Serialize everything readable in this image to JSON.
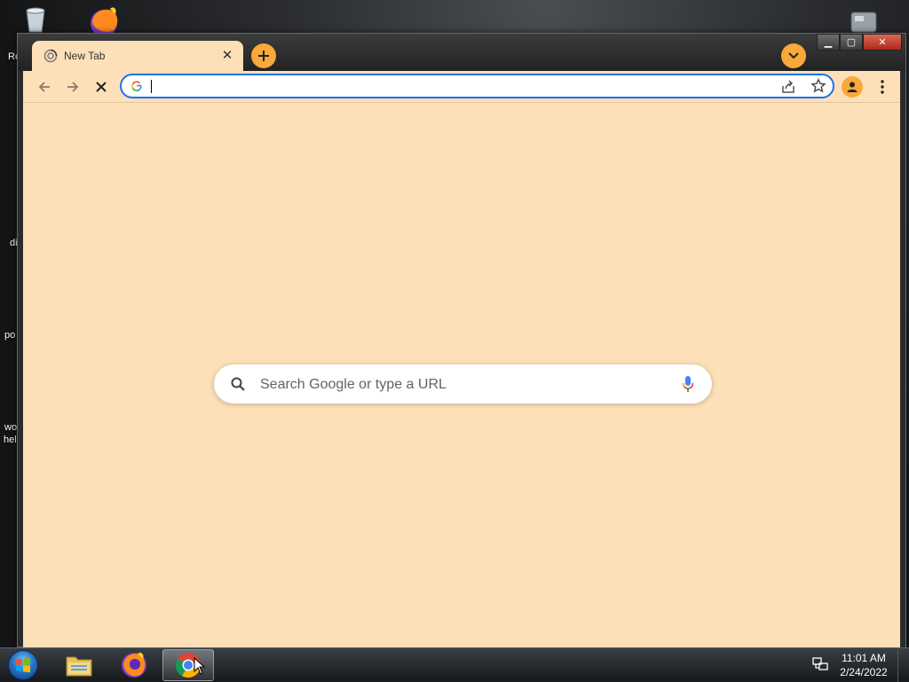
{
  "desktop": {
    "icon_labels": [
      "Re",
      "di",
      "po",
      "wo",
      "hel"
    ]
  },
  "browser": {
    "tab": {
      "title": "New Tab",
      "close_glyph": "✕"
    },
    "window_controls": {
      "minimize": "▁",
      "maximize": "▢",
      "close": "✕"
    },
    "omnibox": {
      "value": "",
      "placeholder": ""
    },
    "ntp": {
      "search_placeholder": "Search Google or type a URL"
    },
    "colors": {
      "theme_bg": "#fee0b8",
      "accent": "#f8a93a",
      "focus_ring": "#1a73e8"
    }
  },
  "taskbar": {
    "clock_time": "11:01 AM",
    "clock_date": "2/24/2022",
    "pinned": [
      "windows-explorer-icon",
      "firefox-icon",
      "chrome-icon"
    ]
  }
}
